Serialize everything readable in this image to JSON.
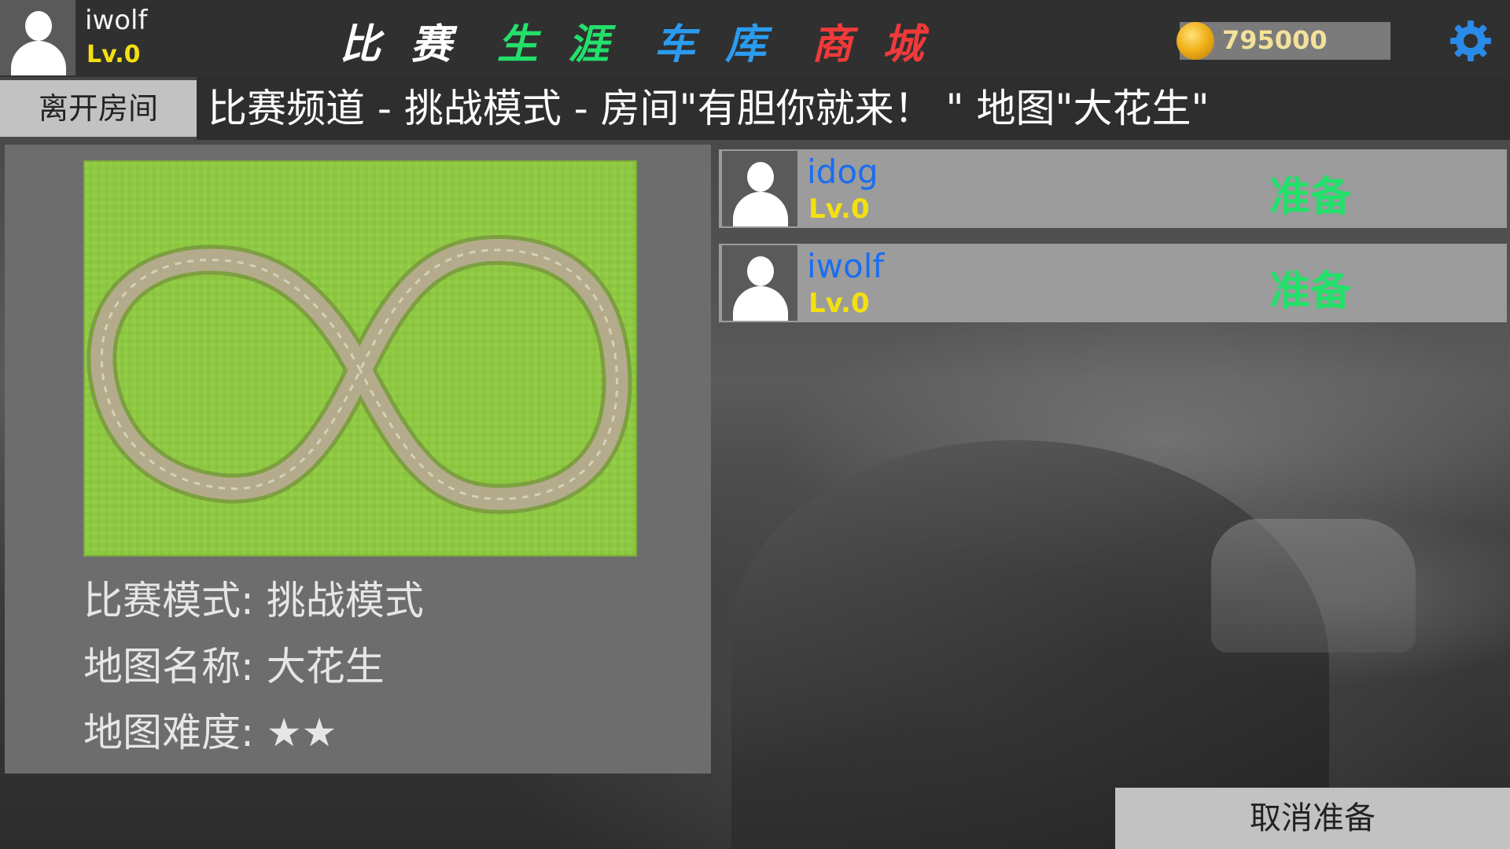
{
  "user": {
    "name": "iwolf",
    "level": "Lv.0"
  },
  "nav": {
    "tabs": [
      {
        "label": "比 赛",
        "color": "#ffffff"
      },
      {
        "label": "生 涯",
        "color": "#22e06a"
      },
      {
        "label": "车 库",
        "color": "#2a9cf0"
      },
      {
        "label": "商 城",
        "color": "#f03a3a"
      }
    ]
  },
  "coins": {
    "value": "795000",
    "icon": "gold-coin-icon"
  },
  "settings": {
    "icon": "gear-icon",
    "color": "#2a8ae8"
  },
  "room": {
    "leave_label": "离开房间",
    "title": "比赛频道 - 挑战模式 - 房间\"有胆你就来！ \" 地图\"大花生\""
  },
  "map_info": {
    "preview_icon": "infinity-track-map",
    "mode_line": "比赛模式: 挑战模式",
    "name_line": "地图名称: 大花生",
    "difficulty_line": "地图难度: ★★"
  },
  "players": [
    {
      "name": "idog",
      "level": "Lv.0",
      "status": "准备"
    },
    {
      "name": "iwolf",
      "level": "Lv.0",
      "status": "准备"
    }
  ],
  "actions": {
    "cancel_ready_label": "取消准备"
  }
}
